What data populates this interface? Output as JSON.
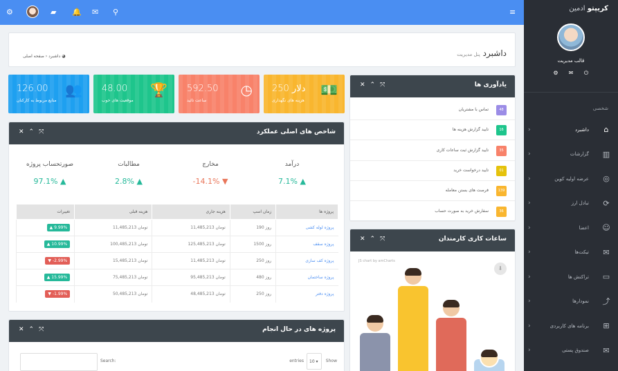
{
  "brand": {
    "name": "کریپتو",
    "suffix": "ادمین"
  },
  "user": {
    "name": "قالب مدیریت"
  },
  "sidebar": {
    "section": "شخصی",
    "items": [
      {
        "label": "داشبرد",
        "icon": "home-icon",
        "glyph": "⌂",
        "active": true
      },
      {
        "label": "گزارشات",
        "icon": "bar-chart-icon",
        "glyph": "▥"
      },
      {
        "label": "عرضه اولیه کوین",
        "icon": "compass-icon",
        "glyph": "◎"
      },
      {
        "label": "تبادل ارز",
        "icon": "exchange-icon",
        "glyph": "⟳"
      },
      {
        "label": "اعضا",
        "icon": "members-icon",
        "glyph": "☺"
      },
      {
        "label": "تیکت‌ها",
        "icon": "tickets-icon",
        "glyph": "✉"
      },
      {
        "label": "تراکنش ها",
        "icon": "folder-icon",
        "glyph": "▭"
      },
      {
        "label": "نمودارها",
        "icon": "line-chart-icon",
        "glyph": "⤴"
      },
      {
        "label": "برنامه های کاربردی",
        "icon": "apps-grid-icon",
        "glyph": "⊞"
      },
      {
        "label": "صندوق پستی",
        "icon": "mailbox-icon",
        "glyph": "✉"
      }
    ]
  },
  "page": {
    "title": "داشبرد",
    "subtitle": "پنل مدیریت",
    "crumb_home": "صفحه اصلی",
    "crumb_current": "داشبرد"
  },
  "stats": [
    {
      "value": "126.00",
      "label": "منابع مربوط به کارکنان",
      "color": "#1ea0f0",
      "glyph": "👥"
    },
    {
      "value": "48.00",
      "label": "موقعیت های خوب",
      "color": "#1ec58c",
      "glyph": "🏆"
    },
    {
      "value": "592.50",
      "label": "ساعت تائید",
      "color": "#f8826a",
      "glyph": "◷"
    },
    {
      "value": "250 دلار",
      "label": "هزینه های نگهداری",
      "color": "#f9b62f",
      "glyph": "💵"
    }
  ],
  "kpi_panel": {
    "title": "شاخص های اصلی عملکرد",
    "items": [
      {
        "label": "درآمد",
        "value": "7.1%",
        "dir": "up"
      },
      {
        "label": "مخارج",
        "value": "-14.1%",
        "dir": "down"
      },
      {
        "label": "مطالبات",
        "value": "2.8%",
        "dir": "up"
      },
      {
        "label": "صورتحساب پروژه",
        "value": "97.1%",
        "dir": "up"
      }
    ]
  },
  "table": {
    "headers": [
      "پروژه ها",
      "زمان اسپ",
      "هزینه جاری",
      "هزینه قبلی",
      "تغییرات"
    ],
    "rows": [
      [
        "پروژه لوله کشی",
        "190 روز",
        "11,485,213 تومان",
        "11,485,213 تومان",
        "9.99%",
        "up"
      ],
      [
        "پروژه سقف",
        "1500 روز",
        "125,485,213 تومان",
        "100,485,213 تومان",
        "10.99%",
        "up"
      ],
      [
        "پروژه کف سازی",
        "250 روز",
        "11,485,213 تومان",
        "15,485,213 تومان",
        "-2.99%",
        "down"
      ],
      [
        "پروژه ساختمان",
        "480 روز",
        "95,485,213 تومان",
        "75,485,213 تومان",
        "15.99%",
        "up"
      ],
      [
        "پروژه دفتر",
        "250 روز",
        "48,485,213 تومان",
        "50,485,213 تومان",
        "-1.99%",
        "down"
      ]
    ]
  },
  "reminders": {
    "title": "یادآوری ها",
    "items": [
      {
        "text": "تماس با مشتریان",
        "badge": "48",
        "color": "#9b8ce6"
      },
      {
        "text": "تایید گزارش هزینه ها",
        "badge": "16",
        "color": "#1ec58c"
      },
      {
        "text": "تایید گزارش ثبت ساعات کاری",
        "badge": "35",
        "color": "#f8826a"
      },
      {
        "text": "تایید درخواست خرید",
        "badge": "01",
        "color": "#e5c20c"
      },
      {
        "text": "فرصت های بستن معامله",
        "badge": "139",
        "color": "#f9b62f"
      },
      {
        "text": "سفارش خرید به صورت حساب",
        "badge": "36",
        "color": "#f9b62f"
      }
    ]
  },
  "hours": {
    "title": "ساعات کاری کارمندان",
    "credit": "JS chart by amCharts"
  },
  "projects": {
    "title": "پروژه های در حال انجام",
    "show": "Show",
    "entries": "entries",
    "length": "10",
    "search": "Search:"
  }
}
